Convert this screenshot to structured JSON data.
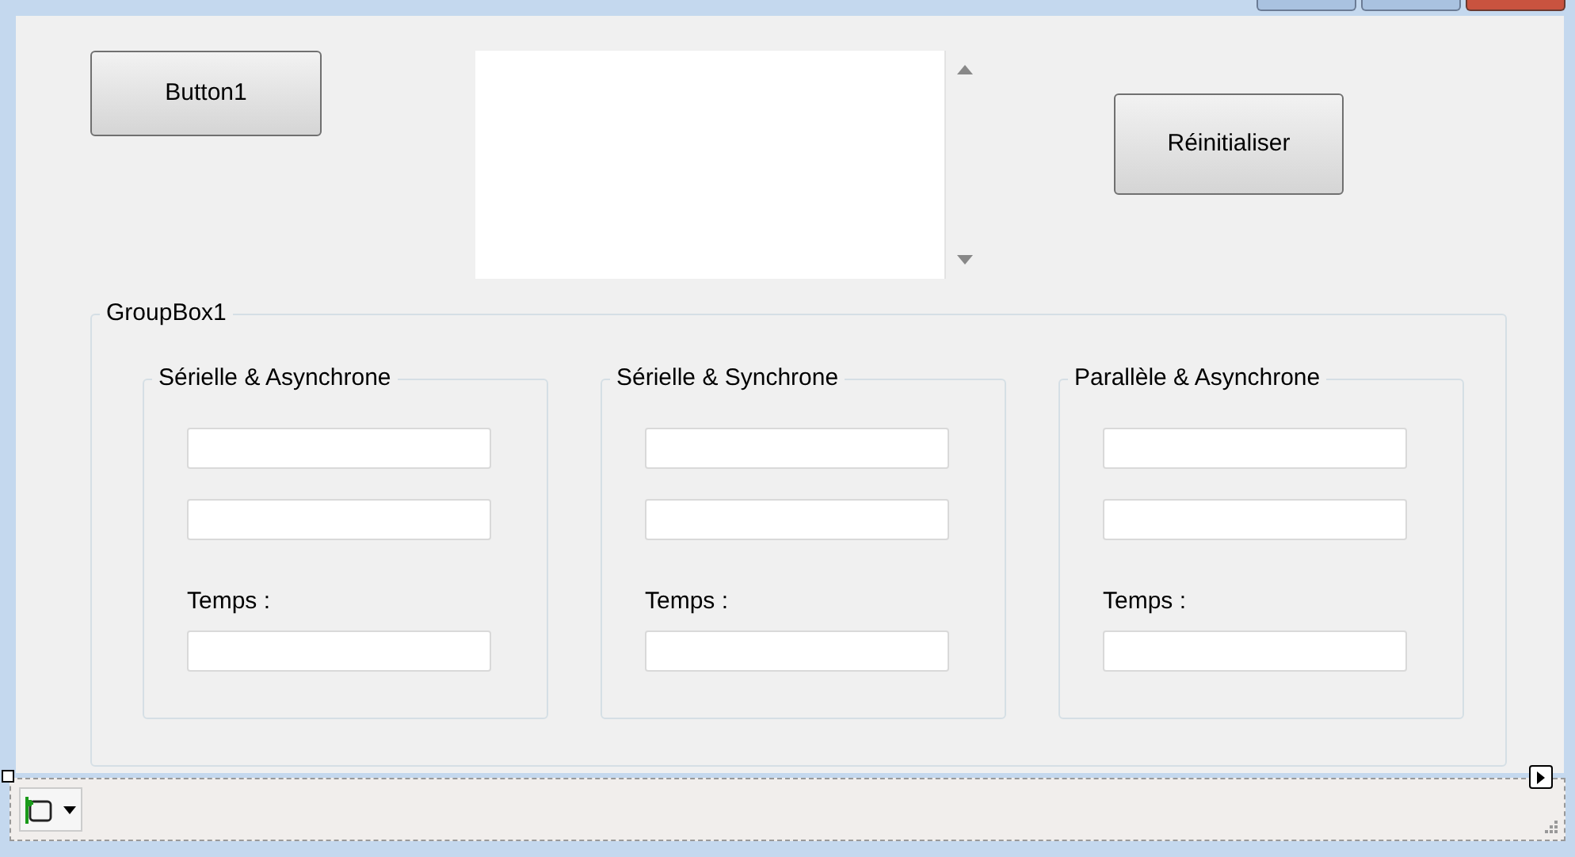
{
  "button1": {
    "label": "Button1"
  },
  "reset_button": {
    "label": "Réinitialiser"
  },
  "group_box": {
    "title": "GroupBox1",
    "groups": [
      {
        "title": "Sérielle & Asynchrone",
        "time_label": "Temps :"
      },
      {
        "title": "Sérielle & Synchrone",
        "time_label": "Temps :"
      },
      {
        "title": "Parallèle & Asynchrone",
        "time_label": "Temps :"
      }
    ]
  }
}
